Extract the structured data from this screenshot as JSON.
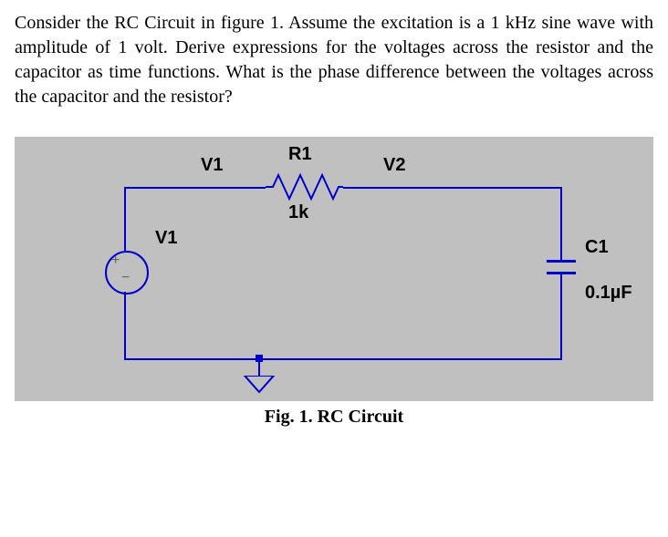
{
  "problem": {
    "text": "Consider the RC Circuit in figure 1.  Assume the excitation is a 1 kHz sine wave with amplitude of 1 volt.   Derive expressions for the voltages across the resistor and the capacitor as time functions. What is the phase difference between the voltages across the capacitor and the resistor?"
  },
  "figure": {
    "caption": "Fig. 1. RC Circuit",
    "labels": {
      "node_v1": "V1",
      "node_v2": "V2",
      "source_name": "V1",
      "resistor_name": "R1",
      "resistor_value": "1k",
      "capacitor_name": "C1",
      "capacitor_value": "0.1µF",
      "source_plus": "+",
      "source_minus": "−"
    }
  },
  "circuit_data": {
    "excitation": {
      "waveform": "sine",
      "frequency_kHz": 1,
      "amplitude_V": 1
    },
    "components": {
      "R1": {
        "type": "resistor",
        "value_ohm": 1000
      },
      "C1": {
        "type": "capacitor",
        "value_F": 1e-07
      }
    },
    "nodes": [
      "V1",
      "V2",
      "GND"
    ]
  }
}
